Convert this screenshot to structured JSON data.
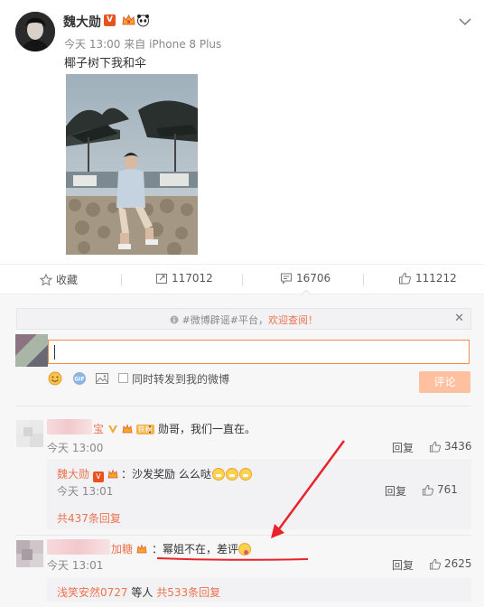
{
  "post": {
    "author": "魏大勋",
    "verified_badge": "V",
    "time": "今天 13:00",
    "source_prefix": "来自",
    "source": "iPhone 8 Plus",
    "text": "椰子树下我和伞"
  },
  "actions": {
    "favorite": "收藏",
    "repost_count": "117012",
    "comment_count": "16706",
    "like_count": "111212"
  },
  "comment_box": {
    "notice_prefix": "#微博辟谣#平台，",
    "notice_link": "欢迎查阅！",
    "notice_close": "✕",
    "repost_label": "同时转发到我的微博",
    "submit_label": "评论"
  },
  "comments": [
    {
      "name_tail": "宝",
      "vip_tag": "铁粉",
      "text": "：勋哥，我们一直在。",
      "time": "今天 13:00",
      "reply_label": "回复",
      "likes": "3436",
      "sub_reply": {
        "name": "魏大勋",
        "text": "：沙发奖励 么么哒",
        "time": "今天 13:01",
        "reply_label": "回复",
        "likes": "761"
      },
      "more_replies": "共437条回复"
    },
    {
      "name_tail": "加糖",
      "text": "：幂姐不在，差评",
      "time": "今天 13:01",
      "reply_label": "回复",
      "likes": "2625",
      "footer_user": "浅笑安然0727",
      "footer_mid": " 等人 ",
      "footer_count": "共533条回复"
    }
  ],
  "colors": {
    "accent": "#eb7350",
    "annotation_red": "#e8232a",
    "submit_bg": "#ffc09f"
  }
}
